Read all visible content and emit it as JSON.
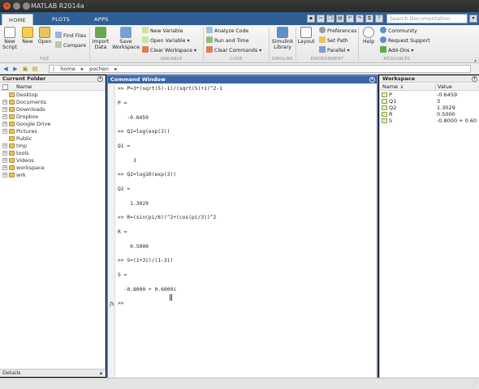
{
  "window": {
    "title": "MATLAB R2014a"
  },
  "tabs": [
    {
      "label": "HOME"
    },
    {
      "label": "PLOTS"
    },
    {
      "label": "APPS"
    }
  ],
  "search": {
    "placeholder": "Search Documentation"
  },
  "ribbon": {
    "new_script": "New Script",
    "new_script_l1": "New",
    "new_script_l2": "Script",
    "new": "New",
    "open": "Open",
    "find_files": "Find Files",
    "compare": "Compare",
    "import_data_l1": "Import",
    "import_data_l2": "Data",
    "save_workspace_l1": "Save",
    "save_workspace_l2": "Workspace",
    "new_variable": "New Variable",
    "open_variable": "Open Variable",
    "clear_workspace": "Clear Workspace",
    "analyze_code": "Analyze Code",
    "run_and_time": "Run and Time",
    "clear_commands": "Clear Commands",
    "simulink_l1": "Simulink",
    "simulink_l2": "Library",
    "layout": "Layout",
    "preferences": "Preferences",
    "set_path": "Set Path",
    "parallel": "Parallel",
    "help": "Help",
    "community": "Community",
    "request_support": "Request Support",
    "add_ons": "Add-Ons",
    "sections": {
      "file": "FILE",
      "variable": "VARIABLE",
      "code": "CODE",
      "simulink": "SIMULINK",
      "environment": "ENVIRONMENT",
      "resources": "RESOURCES"
    }
  },
  "address": {
    "separator": "/",
    "parts": [
      "home",
      "pochen"
    ]
  },
  "current_folder": {
    "title": "Current Folder",
    "column_name": "Name",
    "items": [
      {
        "name": "Desktop",
        "expandable": false
      },
      {
        "name": "Documents",
        "expandable": true
      },
      {
        "name": "Downloads",
        "expandable": true
      },
      {
        "name": "Dropbox",
        "expandable": true
      },
      {
        "name": "Google Drive",
        "expandable": true
      },
      {
        "name": "Pictures",
        "expandable": true
      },
      {
        "name": "Public",
        "expandable": false
      },
      {
        "name": "tmp",
        "expandable": true
      },
      {
        "name": "tools",
        "expandable": true
      },
      {
        "name": "Videos",
        "expandable": true
      },
      {
        "name": "workspace",
        "expandable": true
      },
      {
        "name": "wrk",
        "expandable": true
      }
    ],
    "details_label": "Details"
  },
  "command_window": {
    "title": "Command Window",
    "lines": [
      ">> P=3*(sqrt(5)-1)/(sqrt(5)+1)^2-1",
      "P =",
      "   -0.6459",
      ">> Q1=log(exp(3))",
      "Q1 =",
      "     3",
      ">> Q2=log10(exp(3))",
      "Q2 =",
      "    1.3029",
      ">> R=(sin(pi/6))^2+(cos(pi/3))^2",
      "R =",
      "    0.5000",
      ">> S=(1+3i)/(1-3i)",
      "S =",
      "  -0.8000 + 0.6000i"
    ],
    "prompt": ">>",
    "fx_label": "fx"
  },
  "workspace": {
    "title": "Workspace",
    "col_name": "Name ↓",
    "col_value": "Value",
    "vars": [
      {
        "name": "P",
        "value": "-0.6459"
      },
      {
        "name": "Q1",
        "value": "3"
      },
      {
        "name": "Q2",
        "value": "1.3029"
      },
      {
        "name": "R",
        "value": "0.5000"
      },
      {
        "name": "S",
        "value": "-0.8000 + 0.60"
      }
    ]
  }
}
